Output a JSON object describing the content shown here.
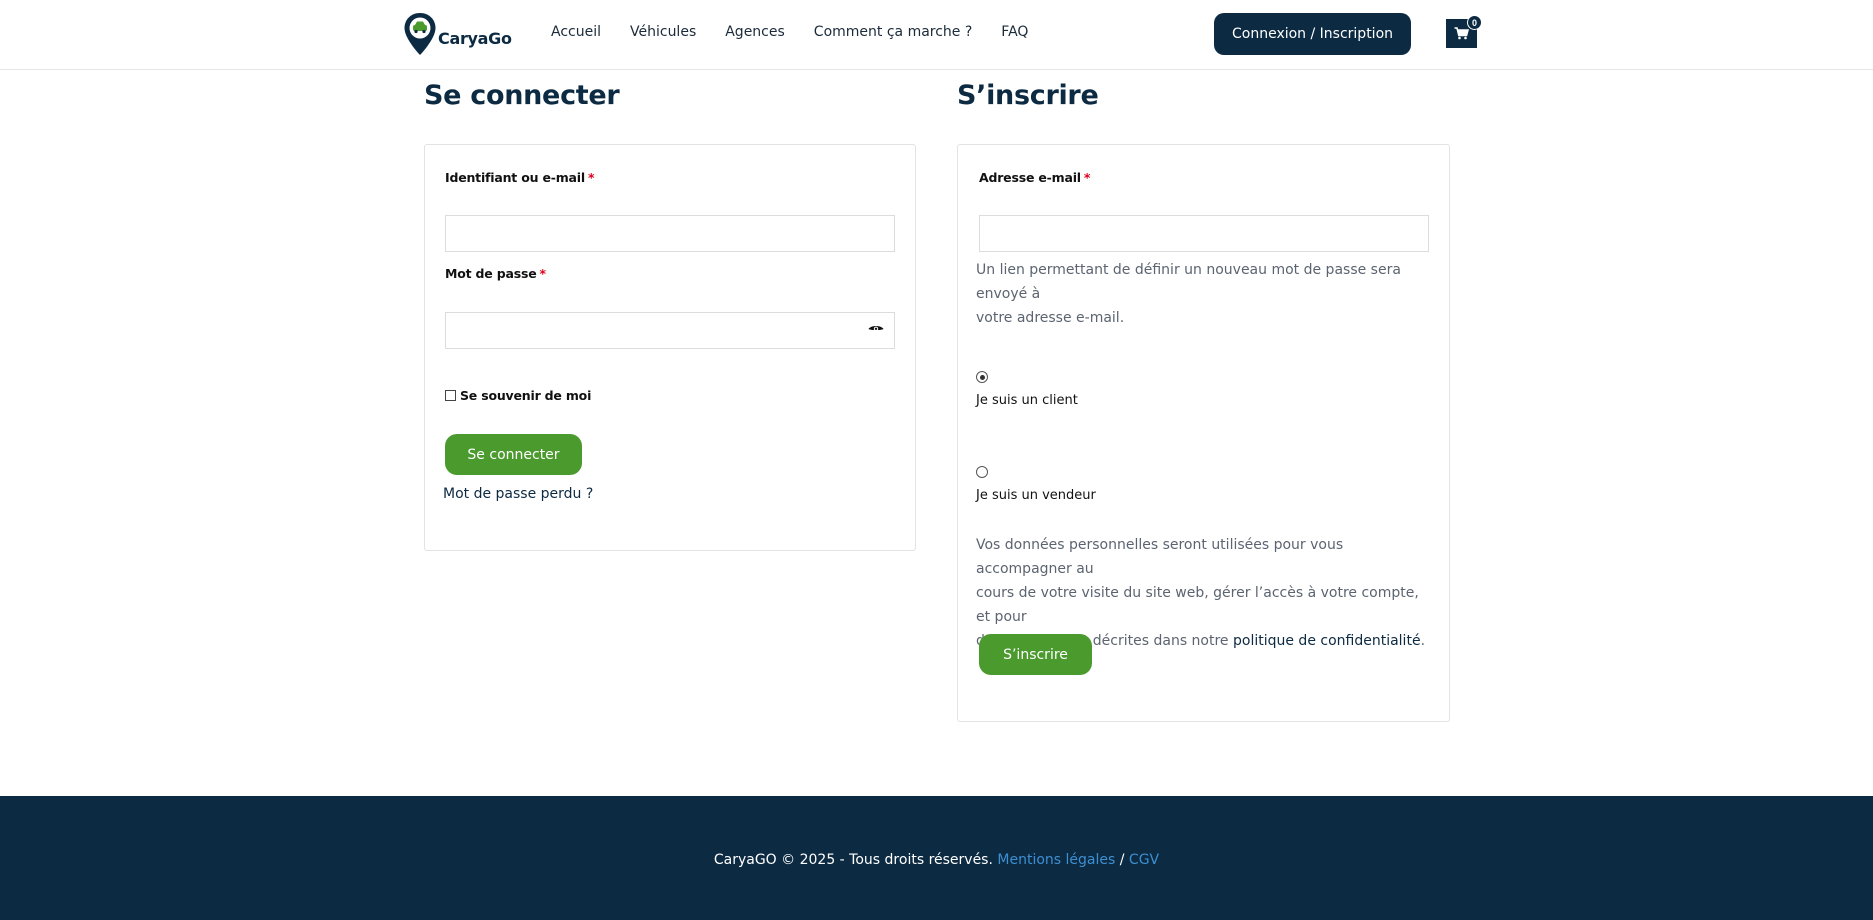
{
  "header": {
    "logo_text": "CaryaGo",
    "nav": [
      "Accueil",
      "Véhicules",
      "Agences",
      "Comment ça marche ?",
      "FAQ"
    ],
    "login_button": "Connexion / Inscription",
    "cart_count": "0"
  },
  "login": {
    "title": "Se connecter",
    "username_label": "Identifiant ou e-mail",
    "username_value": "",
    "password_label": "Mot de passe",
    "password_value": "",
    "required_mark": "*",
    "remember_label": "Se souvenir de moi",
    "remember_checked": false,
    "submit": "Se connecter",
    "lost_password": "Mot de passe perdu ?"
  },
  "register": {
    "title": "S’inscrire",
    "email_label": "Adresse e-mail",
    "email_value": "",
    "required_mark": "*",
    "password_note_line1": "Un lien permettant de définir un nouveau mot de passe sera envoyé à",
    "password_note_line2": "votre adresse e-mail.",
    "role_client": "Je suis un client",
    "role_vendor": "Je suis un vendeur",
    "selected_role": "client",
    "privacy_line1": "Vos données personnelles seront utilisées pour vous accompagner au",
    "privacy_line2": "cours de votre visite du site web, gérer l’accès à votre compte, et pour",
    "privacy_line3_prefix": "d’autres raisons décrites dans notre ",
    "privacy_link": "politique de confidentialité",
    "privacy_line3_suffix": ".",
    "submit": "S’inscrire"
  },
  "footer": {
    "copyright": "CaryaGO © 2025 - Tous droits réservés. ",
    "legal_link": "Mentions légales",
    "separator": " / ",
    "cgv_link": "CGV"
  },
  "colors": {
    "brand_dark": "#0c2a42",
    "accent_green": "#4a9a2e",
    "required_red": "#e2001a",
    "footer_link": "#3d8fd1"
  }
}
